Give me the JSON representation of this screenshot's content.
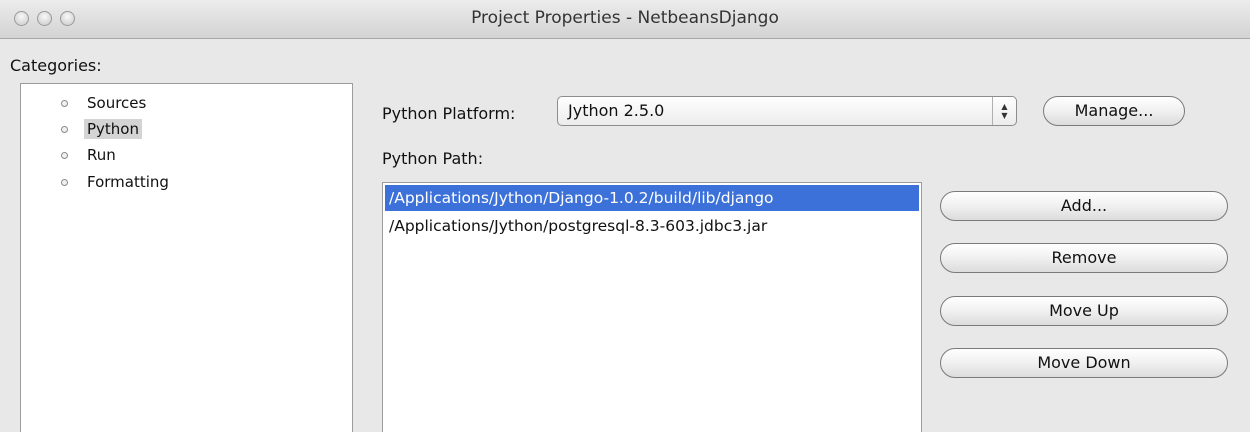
{
  "window": {
    "title": "Project Properties - NetbeansDjango"
  },
  "categories": {
    "label": "Categories:",
    "items": [
      {
        "label": "Sources",
        "selected": false
      },
      {
        "label": "Python",
        "selected": true
      },
      {
        "label": "Run",
        "selected": false
      },
      {
        "label": "Formatting",
        "selected": false
      }
    ]
  },
  "platform": {
    "label": "Python Platform:",
    "value": "Jython 2.5.0",
    "manage_label": "Manage..."
  },
  "path": {
    "label": "Python Path:",
    "entries": [
      {
        "value": "/Applications/Jython/Django-1.0.2/build/lib/django",
        "selected": true
      },
      {
        "value": "/Applications/Jython/postgresql-8.3-603.jdbc3.jar",
        "selected": false
      }
    ],
    "buttons": {
      "add": "Add...",
      "remove": "Remove",
      "move_up": "Move Up",
      "move_down": "Move Down"
    }
  },
  "colors": {
    "selection": "#3b71d9",
    "category_selection": "#d4d4d4"
  }
}
